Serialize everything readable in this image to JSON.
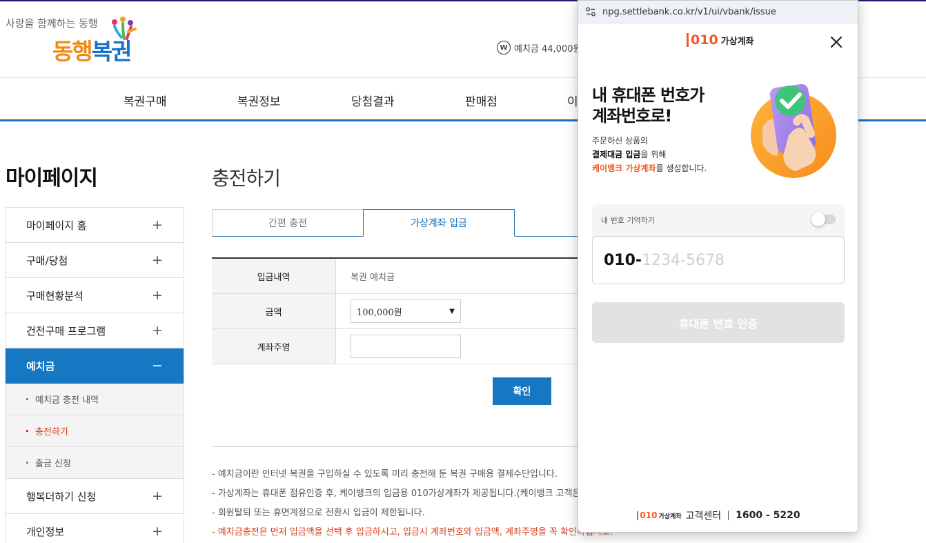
{
  "site": {
    "tagline": "사랑을 함께하는 동행",
    "logo_part1": "동행",
    "logo_part2": "복권",
    "balance_icon": "W",
    "balance_text": "예치금 44,000원",
    "nav": [
      "복권구매",
      "복권정보",
      "당첨결과",
      "판매점",
      "이"
    ]
  },
  "sidebar": {
    "title": "마이페이지",
    "items": [
      {
        "label": "마이페이지 홈",
        "sign": "+"
      },
      {
        "label": "구매/당첨",
        "sign": "+"
      },
      {
        "label": "구매현황분석",
        "sign": "+"
      },
      {
        "label": "건전구매 프로그램",
        "sign": "+"
      },
      {
        "label": "예치금",
        "sign": "−"
      }
    ],
    "subitems": [
      "예치금 충전 내역",
      "충전하기",
      "출금 신청"
    ],
    "items_after": [
      {
        "label": "행복더하기 신청",
        "sign": "+"
      },
      {
        "label": "개인정보",
        "sign": "+"
      }
    ]
  },
  "content": {
    "title": "충전하기",
    "tabs": [
      "간편 충전",
      "가상계좌 입금"
    ],
    "form": {
      "row1_label": "입금내역",
      "row1_value": "복권 예치금",
      "row2_label": "금액",
      "amount_selected": "100,000원",
      "row3_label": "계좌주명",
      "depositor_value": ""
    },
    "confirm_label": "확인",
    "notes": [
      "-   예치금이란 인터넷 복권을 구입하실 수 있도록 미리 충전해 둔 복권 구매용 결제수단입니다.",
      "-   가상계좌는 휴대폰 점유인증 후, 케이뱅크의 입금용 010가상계좌가 제공됩니다.(케이뱅크 고객은",
      "-   회원탈퇴 또는 휴면계정으로 전환시 입금이 제한됩니다.",
      "-   예치금충전은 먼저 입금액을 선택 후 입금하시고, 입금시 계좌번호와 입금액, 계좌주명을 꼭 확인하십시오."
    ]
  },
  "popup": {
    "url": "npg.settlebank.co.kr/v1/ui/vbank/issue",
    "brand_num": "010",
    "brand_text": "가상계좌",
    "hero_line1": "내 휴대폰 번호가",
    "hero_line2": "계좌번호로!",
    "sub_line1": "주문하신 상품의",
    "sub_line2_bold": "결제대금 입금",
    "sub_line2_rest": "을 위해",
    "sub_line3_orange": "케이뱅크 가상계좌",
    "sub_line3_rest": "를 생성합니다.",
    "remember_label": "내 번호 기억하기",
    "remember_on": false,
    "phone_prefix": "010-",
    "phone_placeholder": "1234-5678",
    "verify_label": "휴대폰 번호 인증",
    "footer_brand_num": "010",
    "footer_brand_text": "가상계좌",
    "footer_cs": "고객센터",
    "footer_phone": "1600 - 5220"
  },
  "colors": {
    "primary_blue": "#1678c2",
    "accent_orange": "#f05a28",
    "alert_red": "#d93b17"
  }
}
